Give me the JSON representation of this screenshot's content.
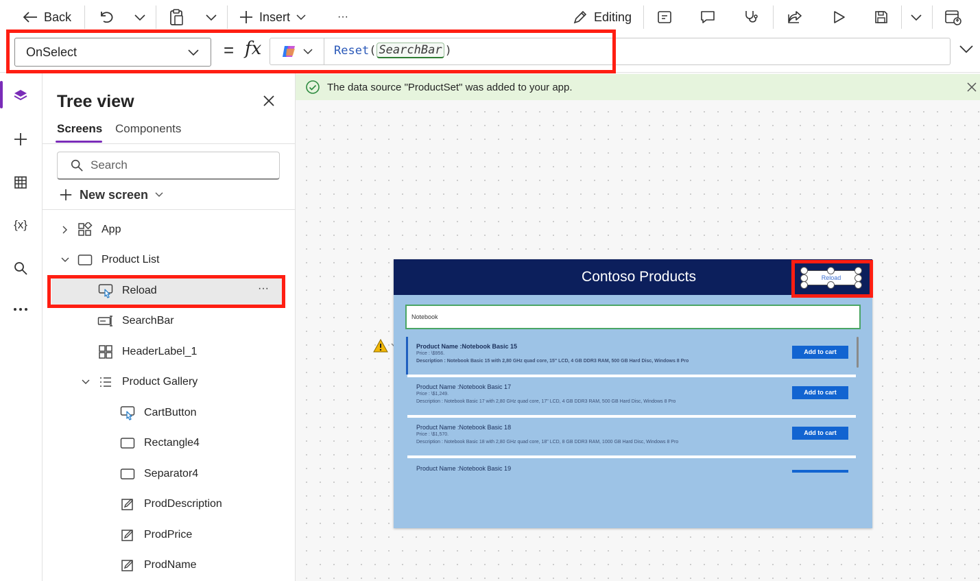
{
  "toolbar": {
    "back_label": "Back",
    "insert_label": "Insert",
    "more_label": "···",
    "editing_label": "Editing"
  },
  "formula": {
    "property": "OnSelect",
    "equals": "=",
    "fx": "fx",
    "function_name": "Reset",
    "open_paren": "(",
    "argument": "SearchBar",
    "close_paren": ")"
  },
  "tree": {
    "title": "Tree view",
    "tabs": [
      "Screens",
      "Components"
    ],
    "search_placeholder": "Search",
    "new_screen_label": "New screen",
    "selected_more": "···",
    "nodes": {
      "app": "App",
      "product_list": "Product List",
      "reload": "Reload",
      "searchbar": "SearchBar",
      "headerlabel": "HeaderLabel_1",
      "product_gallery": "Product Gallery",
      "cartbutton": "CartButton",
      "rectangle4": "Rectangle4",
      "separator4": "Separator4",
      "proddescription": "ProdDescription",
      "prodprice": "ProdPrice",
      "prodname": "ProdName"
    }
  },
  "notification": {
    "message": "The data source \"ProductSet\" was added to your app."
  },
  "preview": {
    "title": "Contoso Products",
    "reload_button": "Reload",
    "search_value": "Notebook",
    "cart_label": "Add to cart",
    "products": [
      {
        "name": "Product Name :Notebook Basic 15",
        "price": "Price :   \\$956.",
        "description": "Description : Notebook Basic 15 with 2,80 GHz quad core, 15\" LCD, 4 GB DDR3 RAM, 500 GB Hard Disc, Windows 8 Pro"
      },
      {
        "name": "Product Name :Notebook Basic 17",
        "price": "Price :   \\$1,249.",
        "description": "Description : Notebook Basic 17 with 2,80 GHz quad core, 17\" LCD, 4 GB DDR3 RAM, 500 GB Hard Disc, Windows 8 Pro"
      },
      {
        "name": "Product Name :Notebook Basic 18",
        "price": "Price :   \\$1,570.",
        "description": "Description : Notebook Basic 18 with 2,80 GHz quad core, 18\" LCD, 8 GB DDR3 RAM, 1000 GB Hard Disc, Windows 8 Pro"
      },
      {
        "name": "Product Name :Notebook Basic 19",
        "price": "",
        "description": ""
      }
    ]
  },
  "colors": {
    "accent": "#7a2cb8",
    "highlight_box": "#ff1e12",
    "app_header": "#0c1f5c",
    "app_body": "#9dc3e6",
    "cart_button": "#1264d1",
    "notification_bg": "#e6f4dd"
  }
}
